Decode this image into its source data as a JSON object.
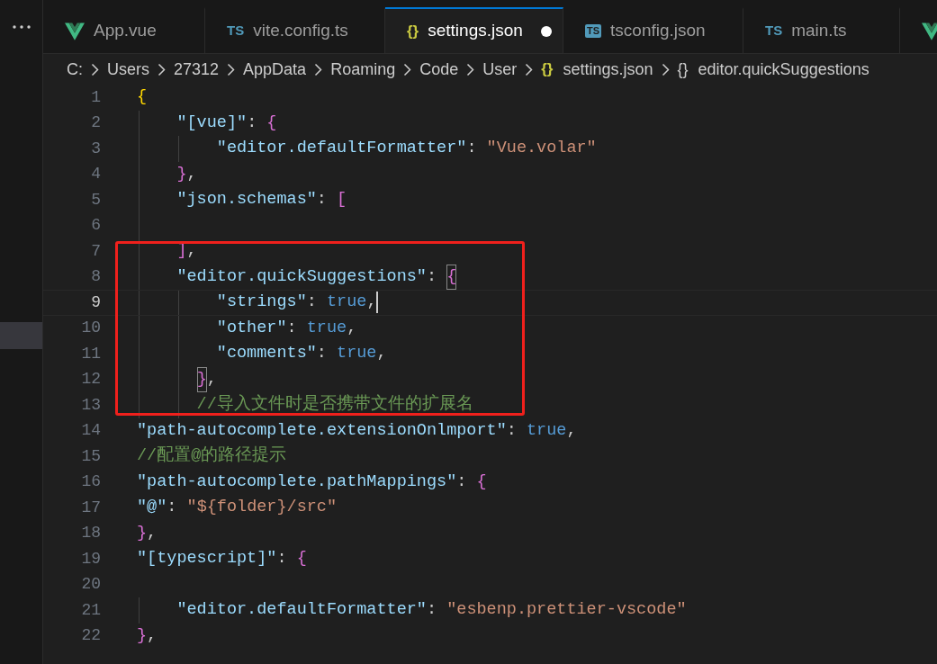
{
  "tabs": [
    {
      "label": "App.vue",
      "kind": "vue",
      "selected": false,
      "modified": false
    },
    {
      "label": "vite.config.ts",
      "kind": "ts",
      "icon_text": "TS",
      "selected": false,
      "modified": false
    },
    {
      "label": "settings.json",
      "kind": "json",
      "icon_text": "{}",
      "selected": true,
      "modified": true
    },
    {
      "label": "tsconfig.json",
      "kind": "tsconfig",
      "icon_text": "TS",
      "selected": false,
      "modified": false
    },
    {
      "label": "main.ts",
      "kind": "ts",
      "icon_text": "TS",
      "selected": false,
      "modified": false
    },
    {
      "kind": "vue",
      "selected": false,
      "modified": false
    }
  ],
  "breadcrumb": [
    {
      "label": "C:"
    },
    {
      "label": "Users"
    },
    {
      "label": "27312"
    },
    {
      "label": "AppData"
    },
    {
      "label": "Roaming"
    },
    {
      "label": "Code"
    },
    {
      "label": "User"
    },
    {
      "label": "settings.json",
      "kind": "json",
      "icon_text": "{}"
    },
    {
      "label": "editor.quickSuggestions",
      "kind": "object",
      "icon_text": "{}"
    }
  ],
  "editor": {
    "lines": [
      {
        "number": "1",
        "tokens": [
          {
            "kind": "bracket",
            "text": "{",
            "color": "#ffd700"
          }
        ]
      },
      {
        "number": "2",
        "tokens": [
          {
            "kind": "key",
            "text": "    \"[vue]\""
          },
          {
            "kind": "punct",
            "text": ": "
          },
          {
            "kind": "bracket",
            "text": "{",
            "color": "#da70d6"
          }
        ]
      },
      {
        "number": "3",
        "tokens": [
          {
            "kind": "key",
            "text": "        \"editor.defaultFormatter\""
          },
          {
            "kind": "punct",
            "text": ": "
          },
          {
            "kind": "string",
            "text": "\"Vue.volar\""
          }
        ]
      },
      {
        "number": "4",
        "tokens": [
          {
            "kind": "bracket",
            "text": "    }",
            "color": "#da70d6"
          },
          {
            "kind": "punct",
            "text": ","
          }
        ]
      },
      {
        "number": "5",
        "tokens": [
          {
            "kind": "key",
            "text": "    \"json.schemas\""
          },
          {
            "kind": "punct",
            "text": ": "
          },
          {
            "kind": "bracket",
            "text": "[",
            "color": "#da70d6"
          }
        ]
      },
      {
        "number": "6"
      },
      {
        "kind": "highlight_frame",
        "lines": [
          {
            "number": "7",
            "tokens": [
              {
                "kind": "bracket",
                "text": "    ]",
                "color": "#da70d6"
              },
              {
                "kind": "punct",
                "text": ","
              }
            ]
          },
          {
            "number": "8",
            "tokens": [
              {
                "kind": "key",
                "text": "    \"editor.quickSuggestions\""
              },
              {
                "kind": "punct",
                "text": ": "
              },
              {
                "kind": "bracket",
                "text": "{",
                "color": "#da70d6",
                "matched": true
              }
            ]
          },
          {
            "number": "9",
            "current": true,
            "tokens": [
              {
                "kind": "key",
                "text": "        \"strings\""
              },
              {
                "kind": "punct",
                "text": ": "
              },
              {
                "kind": "keyword",
                "text": "true"
              },
              {
                "kind": "punct",
                "text": ","
              }
            ]
          },
          {
            "number": "10",
            "tokens": [
              {
                "kind": "key",
                "text": "        \"other\""
              },
              {
                "kind": "punct",
                "text": ": "
              },
              {
                "kind": "keyword",
                "text": "true"
              },
              {
                "kind": "punct",
                "text": ","
              }
            ]
          },
          {
            "number": "11",
            "tokens": [
              {
                "kind": "key",
                "text": "        \"comments\""
              },
              {
                "kind": "punct",
                "text": ": "
              },
              {
                "kind": "keyword",
                "text": "true"
              },
              {
                "kind": "punct",
                "text": ","
              }
            ]
          },
          {
            "number": "12",
            "tokens": [
              {
                "kind": "bracket",
                "text": "      }",
                "color": "#da70d6",
                "matched": true
              },
              {
                "kind": "punct",
                "text": ","
              }
            ]
          },
          {
            "number": "13",
            "tokens": [
              {
                "kind": "comment",
                "text": "      //导入文件时是否携带文件的扩展名"
              }
            ]
          }
        ]
      },
      {
        "number": "14",
        "tokens": [
          {
            "kind": "key",
            "text": "\"path-autocomplete.extensionOnlmport\""
          },
          {
            "kind": "punct",
            "text": ": "
          },
          {
            "kind": "keyword",
            "text": "true"
          },
          {
            "kind": "punct",
            "text": ","
          }
        ]
      },
      {
        "number": "15",
        "tokens": [
          {
            "kind": "comment",
            "text": "//配置@的路径提示"
          }
        ]
      },
      {
        "number": "16",
        "tokens": [
          {
            "kind": "key",
            "text": "\"path-autocomplete.pathMappings\""
          },
          {
            "kind": "punct",
            "text": ": "
          },
          {
            "kind": "bracket",
            "text": "{",
            "color": "#da70d6"
          }
        ]
      },
      {
        "number": "17",
        "tokens": [
          {
            "kind": "key",
            "text": "\"@\""
          },
          {
            "kind": "punct",
            "text": ": "
          },
          {
            "kind": "string",
            "text": "\"${folder}/src\""
          }
        ]
      },
      {
        "number": "18",
        "tokens": [
          {
            "kind": "bracket",
            "text": "}",
            "color": "#da70d6"
          },
          {
            "kind": "punct",
            "text": ","
          }
        ]
      },
      {
        "number": "19",
        "tokens": [
          {
            "kind": "key",
            "text": "\"[typescript]\""
          },
          {
            "kind": "punct",
            "text": ": "
          },
          {
            "kind": "bracket",
            "text": "{",
            "color": "#da70d6"
          }
        ]
      },
      {
        "number": "20"
      },
      {
        "number": "21",
        "tokens": [
          {
            "kind": "key",
            "text": "    \"editor.defaultFormatter\""
          },
          {
            "kind": "punct",
            "text": ": "
          },
          {
            "kind": "string",
            "text": "\"esbenp.prettier-vscode\""
          }
        ]
      },
      {
        "number": "22",
        "tokens": [
          {
            "kind": "bracket",
            "text": "}",
            "color": "#da70d6"
          },
          {
            "kind": "punct",
            "text": ","
          }
        ]
      }
    ]
  }
}
